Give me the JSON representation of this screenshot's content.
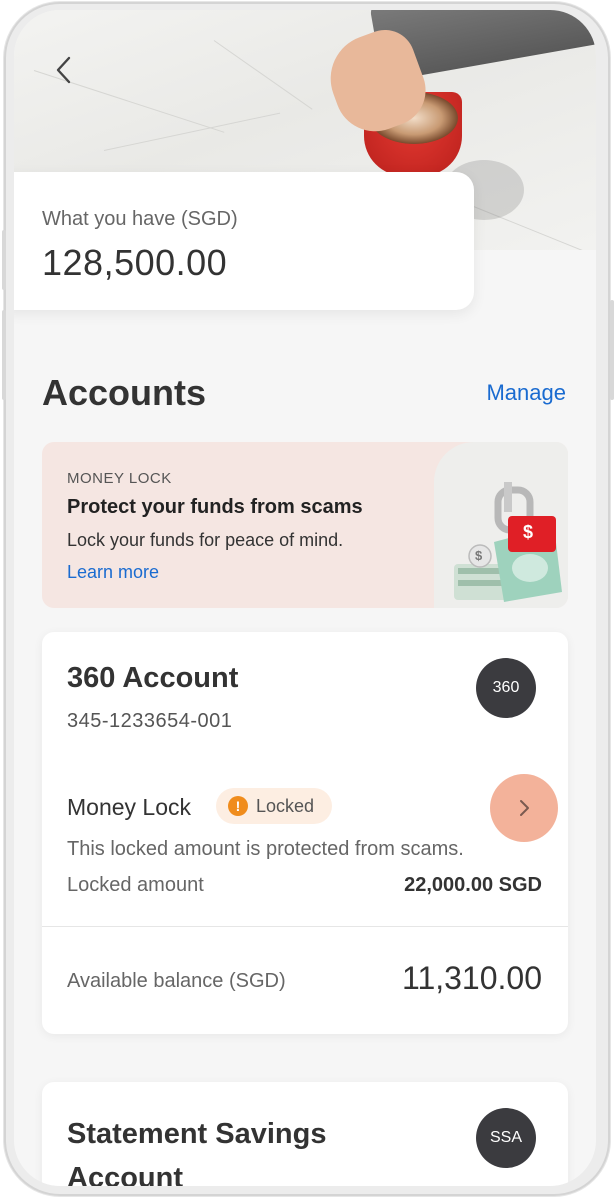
{
  "hero": {
    "back_icon": "chevron-left-icon"
  },
  "balance": {
    "label": "What you have (SGD)",
    "value": "128,500.00"
  },
  "accounts": {
    "title": "Accounts",
    "manage_label": "Manage"
  },
  "promo": {
    "kicker": "MONEY LOCK",
    "title": "Protect your funds from scams",
    "description": "Lock your funds for peace of mind.",
    "link": "Learn more",
    "lock_symbol": "$",
    "coin_symbol": "$",
    "illustration_icon": "padlock-money-icon"
  },
  "account_360": {
    "name": "360 Account",
    "number": "345-1233654-001",
    "badge": "360",
    "money_lock": {
      "title": "Money Lock",
      "status": "Locked",
      "status_icon": "warning-icon",
      "status_glyph": "!",
      "description": "This locked amount is protected from scams.",
      "locked_label": "Locked amount",
      "locked_value": "22,000.00 SGD",
      "arrow_icon": "chevron-right-icon"
    },
    "available_label": "Available balance (SGD)",
    "available_value": "11,310.00"
  },
  "account_ssa": {
    "name": "Statement Savings Account",
    "badge": "SSA"
  },
  "colors": {
    "link": "#1a6bd0",
    "promo_bg": "#f5e6e2",
    "badge_bg": "#3b3b3f",
    "locked_pill_bg": "#fdeee2",
    "warning": "#f08c1c",
    "arrow_highlight": "#f3b29a"
  }
}
